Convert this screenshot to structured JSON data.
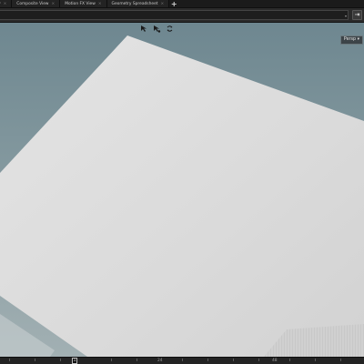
{
  "pane_tabs": [
    {
      "label": "w"
    },
    {
      "label": "Composite View"
    },
    {
      "label": "Motion FX View"
    },
    {
      "label": "Geometry Spreadsheet"
    }
  ],
  "add_tab_icon": "plus-icon",
  "path_bar": {
    "value": "",
    "dropdown_icon": "chevron-down-icon",
    "pin_icon": "arrow-right-icon"
  },
  "viewport": {
    "background_top": "#6e8790",
    "background_bottom": "#a2b0b3",
    "ground_plane_color": "#d9d9d9",
    "view_tool_icons": [
      "select-transform-icon",
      "select-handle-icon",
      "camera-rotate-icon"
    ],
    "camera_menu": "Persp ▾"
  },
  "timeline": {
    "frames": [
      {
        "label": "24"
      },
      {
        "label": "48"
      }
    ],
    "current_frame": "1"
  }
}
